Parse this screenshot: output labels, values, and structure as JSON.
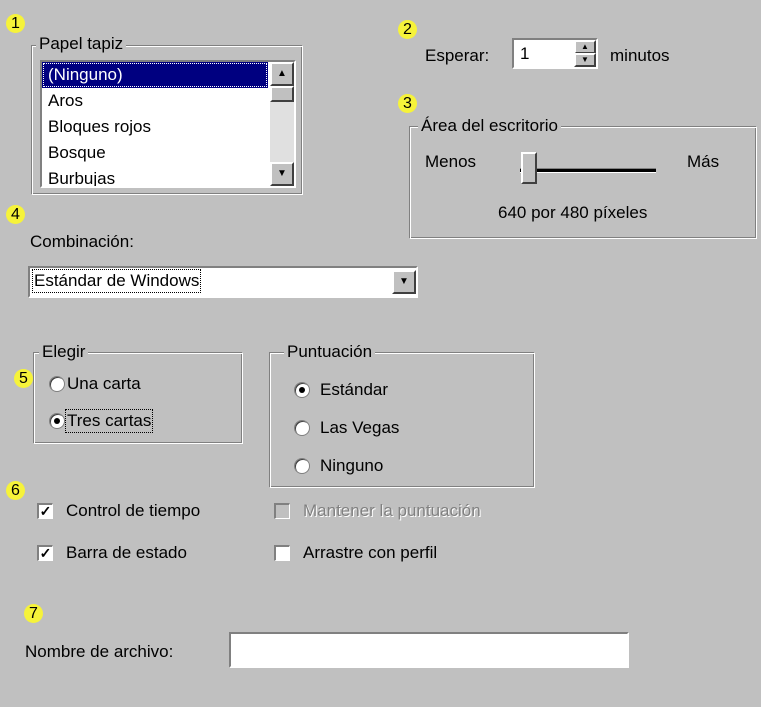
{
  "callouts": [
    "1",
    "2",
    "3",
    "4",
    "5",
    "6",
    "7"
  ],
  "wallpaper": {
    "legend": "Papel tapiz",
    "items": [
      "(Ninguno)",
      "Aros",
      "Bloques rojos",
      "Bosque",
      "Burbujas"
    ],
    "selected_index": 0
  },
  "wait": {
    "label": "Esperar:",
    "value": "1",
    "unit": "minutos"
  },
  "desktop_area": {
    "legend": "Área del escritorio",
    "min_label": "Menos",
    "max_label": "Más",
    "resolution": "640 por 480 píxeles",
    "slider_level": 0
  },
  "scheme": {
    "label": "Combinación:",
    "value": "Estándar de Windows"
  },
  "draw": {
    "legend": "Elegir",
    "options": [
      "Una carta",
      "Tres cartas"
    ],
    "selected": "Tres cartas"
  },
  "scoring": {
    "legend": "Puntuación",
    "options": [
      "Estándar",
      "Las Vegas",
      "Ninguno"
    ],
    "selected": "Estándar"
  },
  "options": {
    "timer": {
      "label": "Control de tiempo",
      "checked": true
    },
    "status_bar": {
      "label": "Barra de estado",
      "checked": true
    },
    "keep_score": {
      "label": "Mantener la puntuación",
      "checked": false,
      "enabled": false
    },
    "outline_drag": {
      "label": "Arrastre con perfil",
      "checked": false
    }
  },
  "filename": {
    "label": "Nombre de archivo:",
    "value": ""
  },
  "icons": {
    "scroll_up": "scroll-up-arrow-icon",
    "scroll_down": "scroll-down-arrow-icon",
    "dropdown": "chevron-down-icon",
    "check": "checkmark-icon"
  },
  "colors": {
    "face": "#c0c0c0",
    "selection": "#000080",
    "callout": "#f6f33a"
  }
}
